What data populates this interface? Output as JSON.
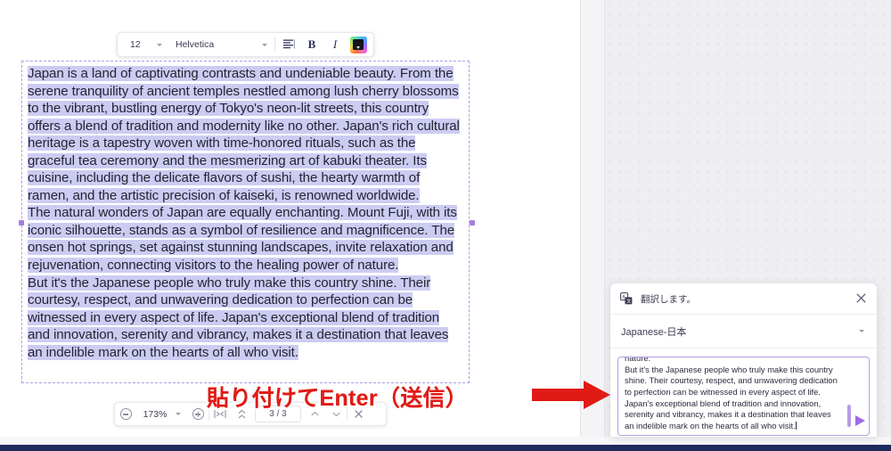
{
  "format_toolbar": {
    "font_size": "12",
    "font_family": "Helvetica",
    "align_icon": "align-left-icon",
    "bold_label": "B",
    "italic_label": "I",
    "color_icon": "text-color-picker-icon"
  },
  "document": {
    "paragraphs": [
      "Japan is a land of captivating contrasts and undeniable beauty. From the serene tranquility of ancient temples nestled among lush cherry blossoms to the vibrant, bustling energy of Tokyo's neon-lit streets, this country offers a blend of tradition and modernity like no other. Japan's rich cultural heritage is a tapestry woven with time-honored rituals, such as the graceful tea ceremony and the mesmerizing art of kabuki theater. Its cuisine, including the delicate flavors of sushi, the hearty warmth of ramen, and the artistic precision of kaiseki, is renowned worldwide.",
      "The natural wonders of Japan are equally enchanting. Mount Fuji, with its iconic silhouette, stands as a symbol of resilience and magnificence. The onsen hot springs, set against stunning landscapes, invite relaxation and rejuvenation, connecting visitors to the healing power of nature.",
      "But it's the Japanese people who truly make this country shine. Their courtesy, respect, and unwavering dedication to perfection can be witnessed in every aspect of life. Japan's exceptional blend of tradition and innovation, serenity and vibrancy, makes it a destination that leaves an indelible mark on the hearts of all who visit."
    ],
    "selection_color": "#ccccf2",
    "frame_border_color": "#b49be0"
  },
  "page_toolbar": {
    "zoom_out_icon": "zoom-out-icon",
    "zoom_level": "173%",
    "zoom_in_icon": "zoom-in-icon",
    "fit_width_icon": "fit-width-icon",
    "fit_page_icon": "fit-page-icon",
    "page_indicator": "3 / 3",
    "prev_page_icon": "chevron-up-icon",
    "next_page_icon": "chevron-down-icon",
    "close_icon": "close-icon"
  },
  "annotation": {
    "text": "貼り付けてEnter（送信）",
    "color": "#e01b16",
    "arrow_icon": "right-arrow-icon"
  },
  "translate_panel": {
    "icon": "translate-icon",
    "title": "翻訳します。",
    "close_icon": "close-icon",
    "language": "Japanese-日本",
    "language_caret_icon": "chevron-down-icon",
    "input_lines": [
      "nature.",
      "But it's the Japanese people who truly make this country",
      "shine. Their courtesy, respect, and unwavering dedication",
      "to perfection can be witnessed in every aspect of life.",
      "Japan's exceptional blend of tradition and innovation,",
      "serenity and vibrancy, makes it a destination that leaves",
      "an indelible mark on the hearts of all who visit."
    ],
    "send_icon": "send-arrow-icon",
    "scrollbar_icon": "vertical-scrollbar-thumb",
    "accent_color": "#9b6ce8"
  },
  "chrome": {
    "bottom_bar_color": "#1d2a5c"
  }
}
